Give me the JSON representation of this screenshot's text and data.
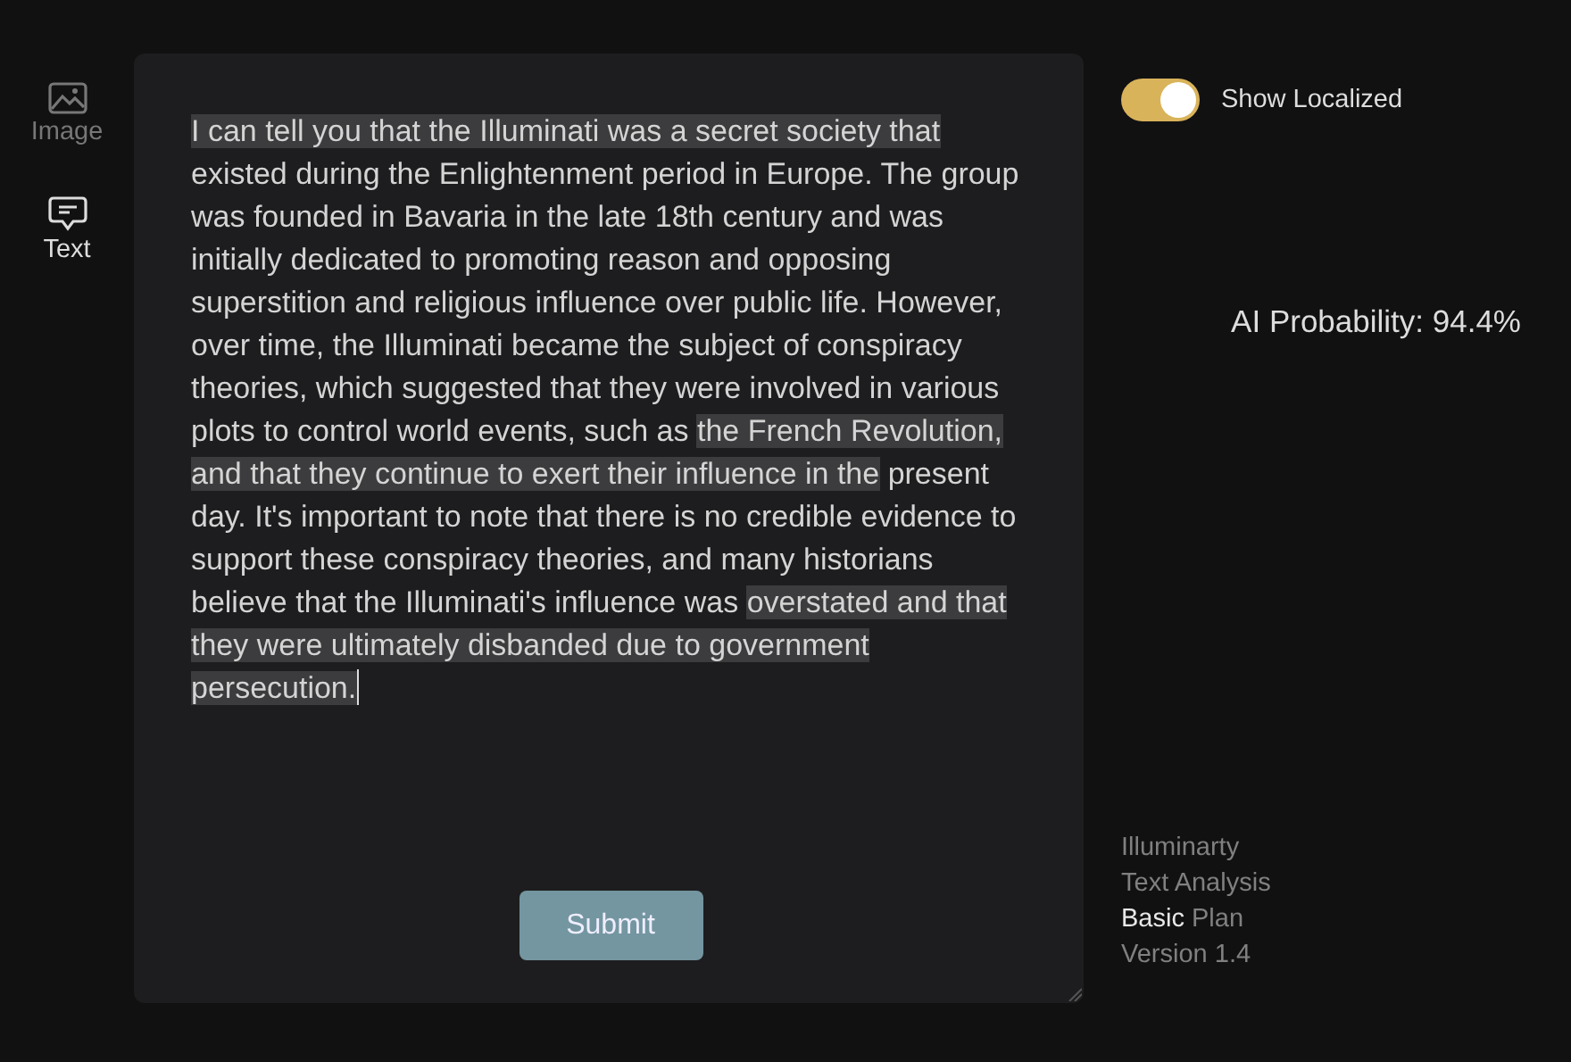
{
  "nav": [
    {
      "label": "Image",
      "kind": "image",
      "selected": false
    },
    {
      "label": "Text",
      "kind": "text",
      "selected": true
    }
  ],
  "editor": {
    "segments": [
      {
        "text": "I can tell you that the Illuminati was a secret society that",
        "highlighted": true
      },
      {
        "text": " existed during the Enlightenment period in Europe. The group was founded in Bavaria in the late 18th century and was initially dedicated to promoting reason and opposing superstition and religious influence over public life. However, over time, the Illuminati became the subject of conspiracy theories, which suggested that they were involved in various plots to control world events, such as ",
        "highlighted": false
      },
      {
        "text": "the French Revolution, and that they continue to exert their influence in the",
        "highlighted": true
      },
      {
        "text": " present day. It's important to note that there is no credible evidence to support these conspiracy theories, and many historians believe that the Illuminati's influence was ",
        "highlighted": false
      },
      {
        "text": "overstated and that they were ultimately disbanded due to government persecution.",
        "highlighted": true
      }
    ],
    "submit": "Submit"
  },
  "toggle": {
    "label": "Show Localized",
    "on": true
  },
  "probability": "AI Probability: 94.4%",
  "info": {
    "name": "Illuminarty",
    "product": "Text Analysis",
    "plan_tier": "Basic",
    "plan_word": "Plan",
    "version": "Version 1.4"
  }
}
